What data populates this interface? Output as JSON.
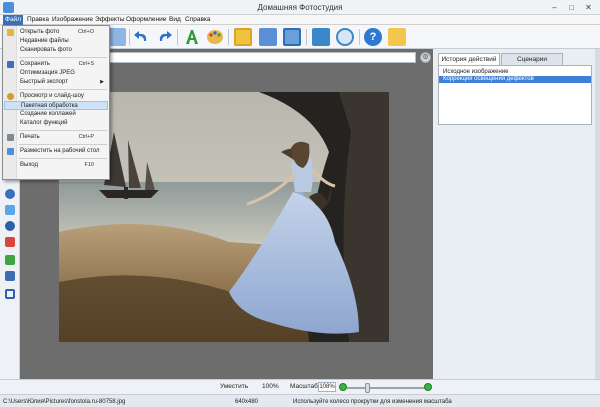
{
  "window": {
    "title": "Домашняя Фотостудия",
    "minimize": "–",
    "maximize": "□",
    "close": "✕"
  },
  "menubar": [
    "Файл",
    "Правка",
    "Изображение",
    "Эффекты",
    "Оформление",
    "Вид",
    "Справка"
  ],
  "file_menu": {
    "items": [
      {
        "label": "Открыть фото",
        "shortcut": "Ctrl+O",
        "icon": "folder-icon"
      },
      {
        "label": "Недавние файлы",
        "shortcut": "",
        "icon": ""
      },
      {
        "label": "Сканировать фото",
        "shortcut": "",
        "icon": ""
      },
      {
        "label": "Сохранить",
        "shortcut": "Ctrl+S",
        "icon": "save-icon"
      },
      {
        "label": "Оптимизация JPEG",
        "shortcut": "",
        "icon": ""
      },
      {
        "label": "Быстрый экспорт",
        "shortcut": "",
        "icon": "",
        "submenu": true
      },
      {
        "label": "Просмотр и слайд-шоу",
        "shortcut": "",
        "icon": "slideshow-icon"
      },
      {
        "label": "Пакетная обработка",
        "shortcut": "",
        "icon": ""
      },
      {
        "label": "Создание коллажей",
        "shortcut": "",
        "icon": ""
      },
      {
        "label": "Каталог функций",
        "shortcut": "",
        "icon": ""
      },
      {
        "label": "Печать",
        "shortcut": "Ctrl+P",
        "icon": "print-icon"
      },
      {
        "label": "Разместить на рабочий стол",
        "shortcut": "",
        "icon": "desktop-icon"
      },
      {
        "label": "Выход",
        "shortcut": "F10",
        "icon": ""
      }
    ],
    "highlighted_index": 7
  },
  "right_panel": {
    "tabs": [
      "История действий",
      "Сценарии"
    ],
    "active_tab": 0,
    "history": [
      "Исходное изображение",
      "Коррекция освещения дефектов"
    ],
    "selected_history": 1
  },
  "zoom": {
    "fit_label": "Уместить",
    "percent_label": "100%",
    "scale_label": "Масштаб:",
    "scale_value": "108%"
  },
  "status": {
    "file_path": "C:\\Users\\Юлия\\Pictures\\fonstola.ru-80758.jpg",
    "dimensions": "640x480",
    "hint": "Используйте колесо прокрутки для изменения масштаба"
  },
  "path_gear": "⚙",
  "colors": {
    "accent": "#3d6fb4",
    "selection": "#3f7fd6",
    "highlight": "#cde1f7"
  }
}
